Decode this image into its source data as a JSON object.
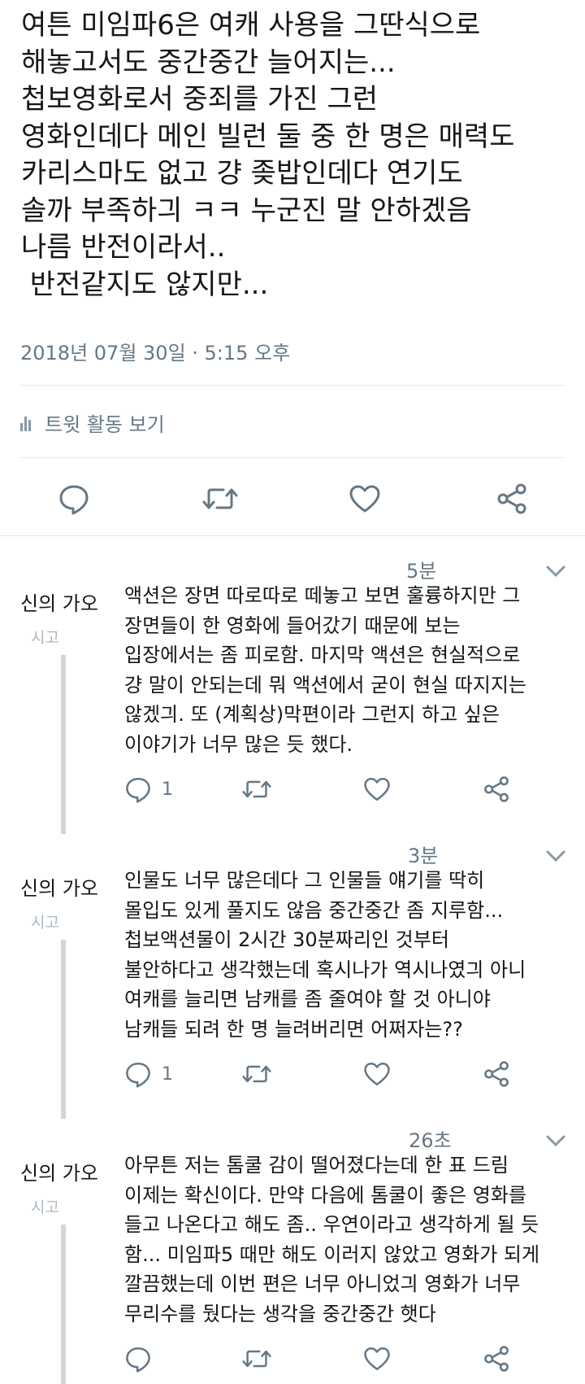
{
  "tweet": {
    "lines": [
      "여튼 미임파6은 여캐 사용을 그딴식으로",
      "해놓고서도 중간중간 늘어지는...",
      "첩보영화로서 중죄를 가진 그런",
      "영화인데다 메인 빌런 둘 중 한 명은 매력도",
      "카리스마도 없고 걍 좆밥인데다 연기도",
      "솔까 부족하긔 ㅋㅋ 누군진 말 안하겠음",
      "나름 반전이라서..",
      " 반전같지도 않지만..."
    ],
    "timestamp": "2018년 07월 30일 · 5:15 오후",
    "activity_label": "트윗 활동 보기"
  },
  "actions": {
    "reply_icon": "reply-icon",
    "retweet_icon": "retweet-icon",
    "like_icon": "heart-icon",
    "share_icon": "share-icon"
  },
  "replies": [
    {
      "time": "5분",
      "name": "신의 가오",
      "sub": "시고",
      "lines": [
        "액션은 장면 따로따로 떼놓고 보면 훌륭하지만 그",
        "장면들이 한 영화에 들어갔기 때문에 보는",
        "입장에서는 좀 피로함. 마지막 액션은 현실적으로",
        "걍 말이 안되는데 뭐 액션에서 굳이 현실 따지지는",
        "않겠긔. 또 (계획상)막편이라 그런지 하고 싶은",
        "이야기가 너무 많은 듯 했다."
      ],
      "reply_count": "1"
    },
    {
      "time": "3분",
      "name": "신의 가오",
      "sub": "시고",
      "lines": [
        "인물도 너무 많은데다 그 인물들 얘기를 딱히",
        "몰입도 있게 풀지도 않음 중간중간 좀 지루함...",
        "첩보액션물이 2시간 30분짜리인 것부터",
        "불안하다고 생각했는데 혹시나가 역시나였긔 아니",
        "여캐를 늘리면 남캐를 좀 줄여야 할 것 아니야",
        "남캐들 되려 한 명 늘려버리면 어쩌자는??"
      ],
      "reply_count": "1"
    },
    {
      "time": "26초",
      "name": "신의 가오",
      "sub": "시고",
      "lines": [
        "아무튼 저는 톰쿨 감이 떨어졌다는데 한 표 드림",
        "이제는 확신이다. 만약 다음에 톰쿨이 좋은 영화를",
        "들고 나온다고 해도 좀.. 우연이라고 생각하게 될 듯",
        "함... 미임파5 때만 해도 이러지 않았고 영화가 되게",
        "깔끔했는데 이번 편은 너무 아니었긔 영화가 너무",
        "무리수를 뒀다는 생각을 중간중간 햇다"
      ],
      "reply_count": ""
    }
  ],
  "colors": {
    "text": "#14171a",
    "secondary": "#657786",
    "icon": "#657786",
    "divider": "#e1e8ed",
    "thread": "#ccd6dd"
  }
}
